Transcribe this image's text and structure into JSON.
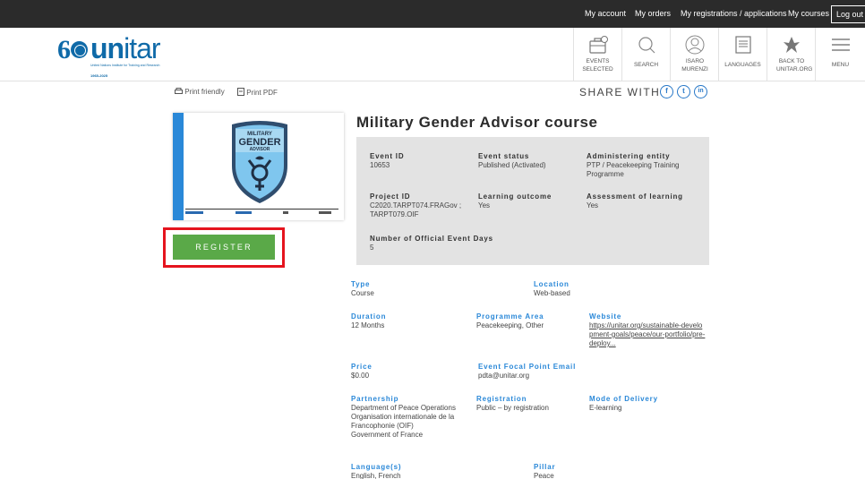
{
  "topbar": {
    "my_account": "My account",
    "my_orders": "My orders",
    "my_registrations": "My registrations / applications",
    "my_courses": "My courses",
    "logout": "Log out"
  },
  "logo": {
    "number": "6",
    "word_bold": "un",
    "word_thin": "itar",
    "tagline": "United Nations Institute for Training and Research",
    "years": "1965-2025"
  },
  "header_nav": [
    {
      "label": "EVENTS SELECTED",
      "icon": "briefcase-icon"
    },
    {
      "label": "SEARCH",
      "icon": "search-icon"
    },
    {
      "label": "ISARO MURENZI",
      "icon": "user-icon"
    },
    {
      "label": "LANGUAGES",
      "icon": "document-icon"
    },
    {
      "label": "BACK TO UNITAR.ORG",
      "icon": "bird-icon"
    },
    {
      "label": "MENU",
      "icon": "menu-icon"
    }
  ],
  "toolbar": {
    "print_friendly": "Print friendly",
    "print_pdf": "Print PDF",
    "share_with": "SHARE WITH",
    "social": [
      "f",
      "t",
      "in"
    ]
  },
  "event_image": {
    "badge_top": "MILITARY",
    "badge_main": "GENDER",
    "badge_sub": "ADVISOR"
  },
  "register_label": "REGISTER",
  "title": "Military Gender Advisor course",
  "summary": {
    "event_id_label": "Event ID",
    "event_id": "10653",
    "event_status_label": "Event status",
    "event_status": "Published (Activated)",
    "admin_entity_label": "Administering entity",
    "admin_entity": "PTP / Peacekeeping Training Programme",
    "project_id_label": "Project ID",
    "project_id": "C2020.TARPT074.FRAGov ; TARPT079.OIF",
    "learning_outcome_label": "Learning outcome",
    "learning_outcome": "Yes",
    "assessment_label": "Assessment of learning",
    "assessment": "Yes",
    "official_days_label": "Number of Official Event Days",
    "official_days": "5"
  },
  "details": {
    "type_label": "Type",
    "type": "Course",
    "location_label": "Location",
    "location": "Web-based",
    "duration_label": "Duration",
    "duration": "12 Months",
    "programme_area_label": "Programme Area",
    "programme_area": "Peacekeeping, Other",
    "website_label": "Website",
    "website": "https://unitar.org/sustainable-development-goals/peace/our-portfolio/pre-deploy...",
    "price_label": "Price",
    "price": "$0.00",
    "focal_email_label": "Event Focal Point Email",
    "focal_email": "pdta@unitar.org",
    "partnership_label": "Partnership",
    "partnership": "Department of Peace Operations\nOrganisation internationale de la Francophonie (OIF)\nGovernment of France",
    "registration_label": "Registration",
    "registration": "Public – by registration",
    "delivery_label": "Mode of Delivery",
    "delivery": "E-learning",
    "language_label": "Language(s)",
    "language": "English, French",
    "pillar_label": "Pillar",
    "pillar": "Peace"
  },
  "colors": {
    "topbar": "#2b2b2b",
    "brand": "#0f6aa8",
    "accent_blue": "#2a88d8",
    "register_green": "#5aa948",
    "highlight_red": "#e5141e",
    "summary_bg": "#e3e3e3"
  }
}
